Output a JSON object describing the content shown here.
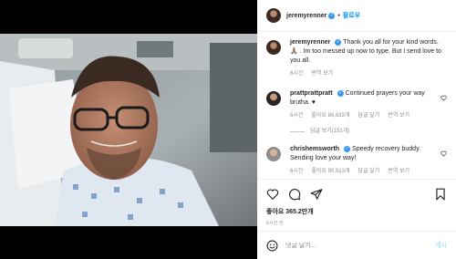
{
  "header": {
    "username": "jeremyrenner",
    "verified_icon": "verified-badge-icon",
    "separator": "•",
    "follow_label": "팔로우"
  },
  "comments": [
    {
      "username": "jeremyrenner",
      "verified": true,
      "text": "Thank you all for your kind words. 🙏🏽 . Im too messed up now to type. But I send love to you all.",
      "time": "6시간",
      "reply_label": "번역 보기"
    },
    {
      "username": "prattprattpratt",
      "verified": true,
      "text": "Continued prayers your way brutha. ♥",
      "time": "6시간",
      "likes": "좋아요 86,633개",
      "reply_label": "답글 달기",
      "translate_label": "번역 보기",
      "view_replies": "답글 보기(151개)"
    },
    {
      "username": "chrishemsworth",
      "verified": true,
      "text": "Speedy recovery buddy. Sending love your way!",
      "time": "6시간",
      "likes": "좋아요 90,513개",
      "reply_label": "답글 달기",
      "translate_label": "번역 보기"
    }
  ],
  "actions": {
    "likes": "좋아요 365.2만개",
    "time": "6시간 전"
  },
  "add_comment": {
    "placeholder": "댓글 달기...",
    "post_label": "게시"
  },
  "colors": {
    "accent": "#0095f6",
    "verified": "#3897f0",
    "muted": "#8e8e8e"
  }
}
